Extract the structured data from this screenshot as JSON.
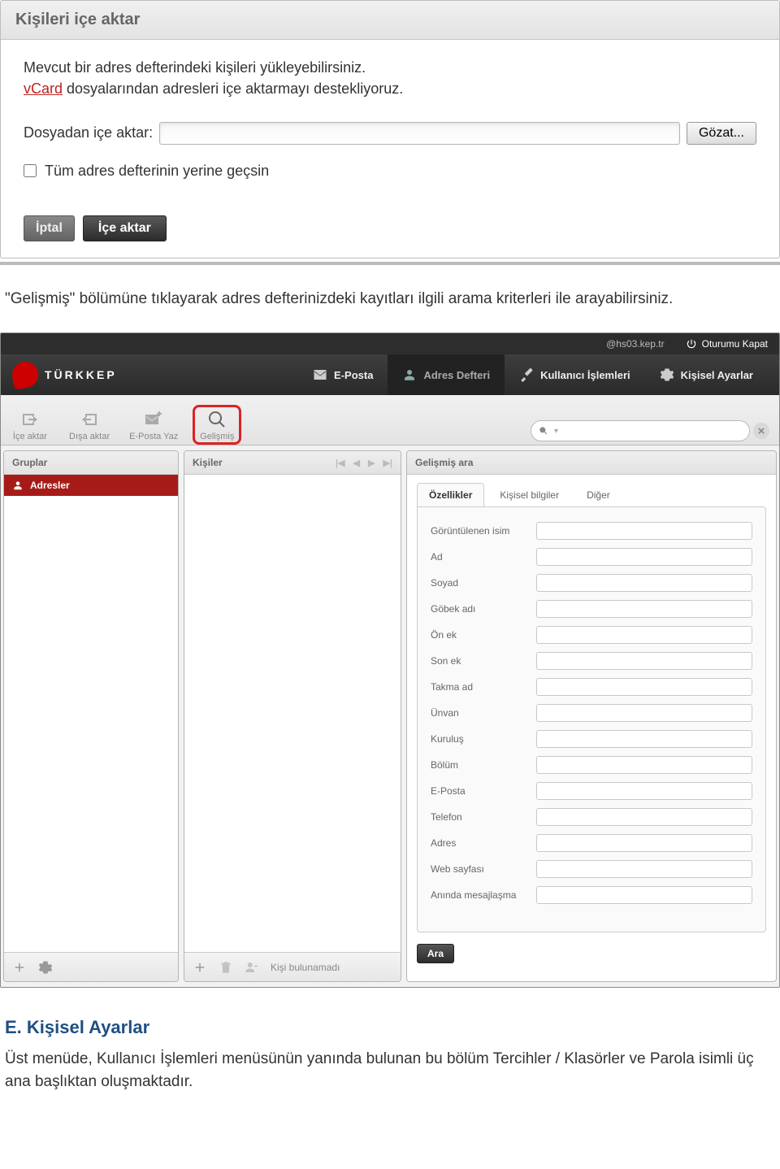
{
  "dialog1": {
    "title": "Kişileri içe aktar",
    "line1": "Mevcut bir adres defterindeki kişileri yükleyebilirsiniz.",
    "vcard": "vCard",
    "line2_rest": " dosyalarından adresleri içe aktarmayı destekliyoruz.",
    "file_label": "Dosyadan içe aktar:",
    "browse": "Gözat...",
    "checkbox_label": "Tüm adres defterinin yerine geçsin",
    "btn_cancel": "İptal",
    "btn_import": "İçe aktar"
  },
  "doc1": {
    "text": "\"Gelişmiş\" bölümüne tıklayarak adres defterinizdeki kayıtları ilgili arama kriterleri ile arayabilirsiniz."
  },
  "app": {
    "top": {
      "user": "@hs03.kep.tr",
      "logout": "Oturumu Kapat"
    },
    "logo": "TÜRKKEP",
    "nav": {
      "mail": "E-Posta",
      "addr": "Adres Defteri",
      "userops": "Kullanıcı İşlemleri",
      "settings": "Kişisel Ayarlar"
    },
    "tools": {
      "import": "İçe aktar",
      "export": "Dışa aktar",
      "compose": "E-Posta Yaz",
      "advanced": "Gelişmiş"
    },
    "col1": {
      "head": "Gruplar",
      "item": "Adresler"
    },
    "col2": {
      "head": "Kişiler",
      "footer": "Kişi bulunamadı"
    },
    "col3": {
      "head": "Gelişmiş ara",
      "tabs": {
        "props": "Özellikler",
        "personal": "Kişisel bilgiler",
        "other": "Diğer"
      },
      "fields": [
        "Görüntülenen isim",
        "Ad",
        "Soyad",
        "Göbek adı",
        "Ön ek",
        "Son ek",
        "Takma ad",
        "Ünvan",
        "Kuruluş",
        "Bölüm",
        "E-Posta",
        "Telefon",
        "Adres",
        "Web sayfası",
        "Anında mesajlaşma"
      ],
      "search_btn": "Ara"
    }
  },
  "doc2": {
    "heading": "E.  Kişisel Ayarlar",
    "text": "Üst menüde, Kullanıcı İşlemleri  menüsünün yanında bulunan bu bölüm Tercihler / Klasörler ve Parola isimli üç ana başlıktan oluşmaktadır."
  }
}
